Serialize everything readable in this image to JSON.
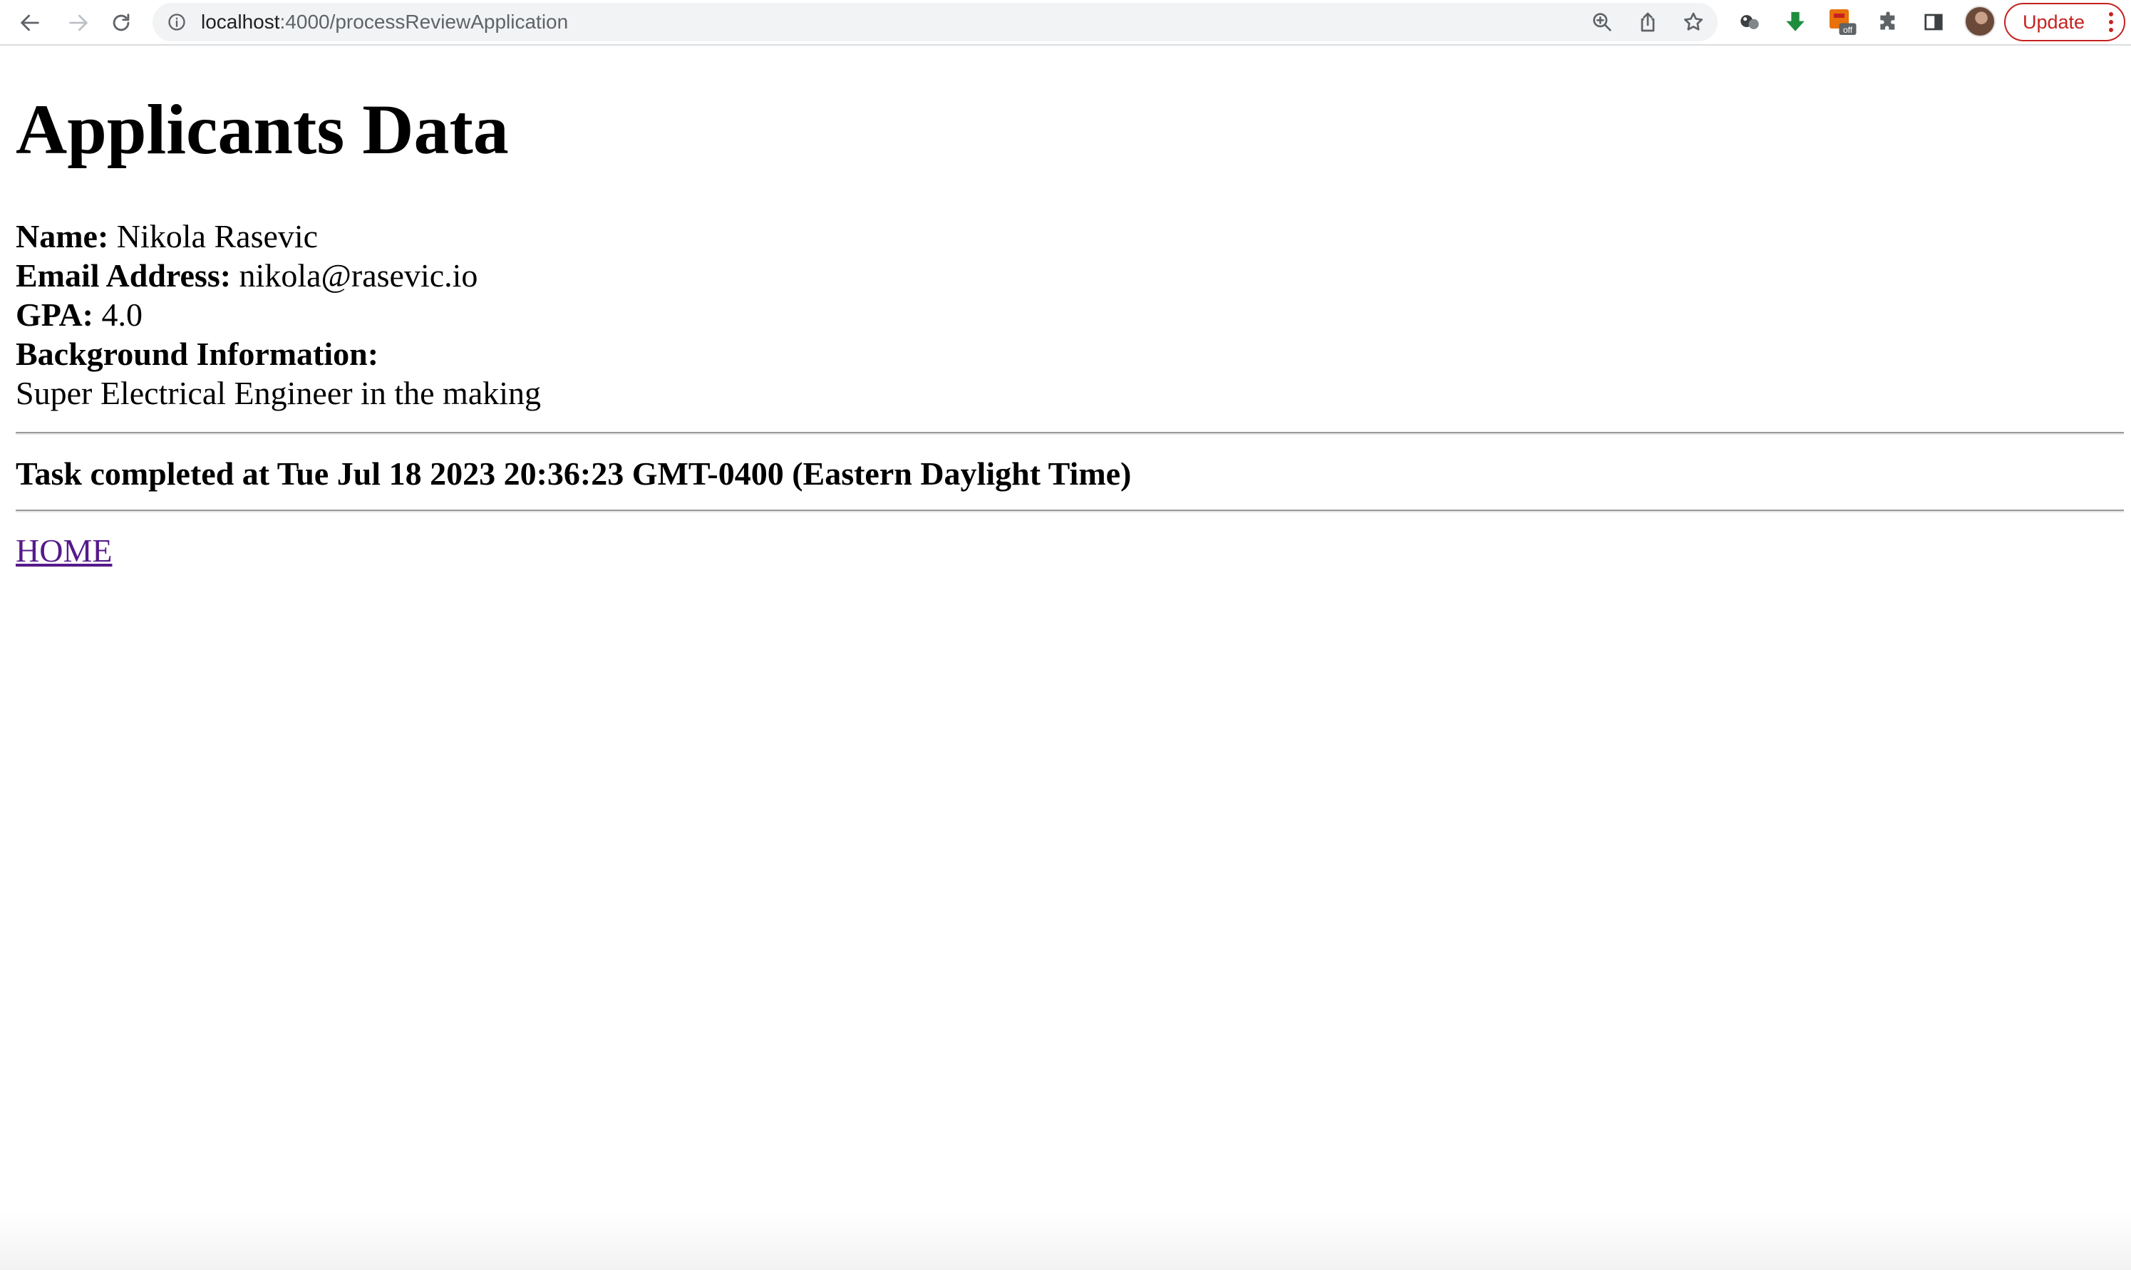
{
  "browser": {
    "url_host": "localhost",
    "url_path": ":4000/processReviewApplication",
    "update_label": "Update",
    "extension_badge": "off",
    "icons": [
      "back-arrow-icon",
      "forward-arrow-icon",
      "reload-icon",
      "info-icon",
      "zoom-icon",
      "share-icon",
      "star-icon",
      "extension-orbs-icon",
      "download-icon",
      "extension-off-icon",
      "puzzle-icon",
      "sidebar-icon",
      "avatar",
      "more-vert-icon"
    ]
  },
  "page": {
    "title": "Applicants Data",
    "fields": {
      "name_label": "Name:",
      "name_value": "Nikola Rasevic",
      "email_label": "Email Address:",
      "email_value": "nikola@rasevic.io",
      "gpa_label": "GPA:",
      "gpa_value": "4.0",
      "background_label": "Background Information:",
      "background_value": "Super Electrical Engineer in the making"
    },
    "task_status": "Task completed at Tue Jul 18 2023 20:36:23 GMT-0400 (Eastern Daylight Time)",
    "home_link": "HOME"
  },
  "colors": {
    "link_visited": "#551a8b",
    "update_accent": "#c5221f",
    "download_icon": "#1e8e3e",
    "extension_icon": "#e8710a"
  }
}
